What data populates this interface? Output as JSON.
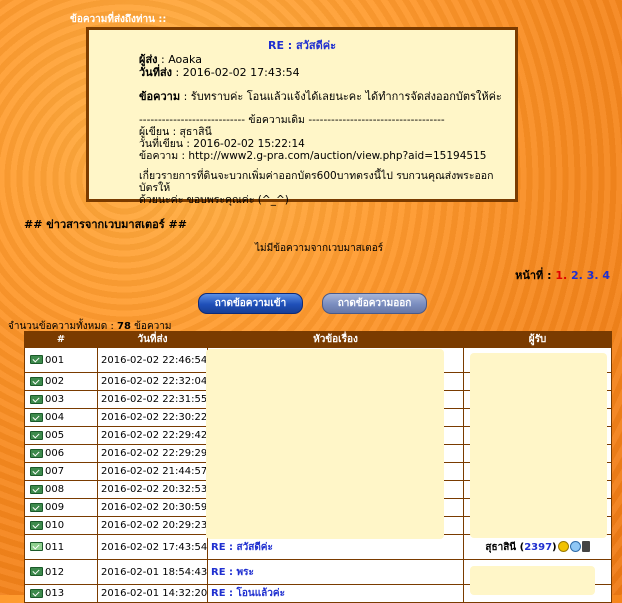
{
  "message": {
    "heading": "ข้อความที่ส่งถึงท่าน ::",
    "title": "RE : สวัสดีค่ะ",
    "sender_label": "ผู้ส่ง",
    "sender": " : Aoaka",
    "date_label": "วันที่ส่ง",
    "date": " : 2016-02-02 17:43:54",
    "body_label": "ข้อความ",
    "body": " : รับทราบค่ะ โอนแล้วแจ้งได้เลยนะคะ ได้ทำการจัดส่งออกบัตรให้ค่ะ",
    "separator": "---------------------------- ข้อความเดิม ------------------------------------",
    "orig_author": "ผู้เขียน : สุธาสินี",
    "orig_date": "วันที่เขียน : 2016-02-02 15:22:14",
    "orig_text": "ข้อความ : http://www2.g-pra.com/auction/view.php?aid=15194515",
    "orig_line1": "เกี่ยวรายการที่ดินจะบวกเพิ่มค่าออกบัตร600บาทตรงนี้ไป รบกวนคุณส่งพระออกบัตรให้",
    "orig_line2": "ด้วยนะค่ะ ขอบพระคุณค่ะ (^_^)"
  },
  "news": {
    "heading": "## ข่าวสารจากเวบมาสเตอร์ ##",
    "text": "ไม่มีข้อความจากเวบมาสเตอร์"
  },
  "pager": {
    "label": "หน้าที่ : ",
    "current": "1",
    "p2": "2",
    "p3": "3",
    "p4": "4"
  },
  "buttons": {
    "inbox": "ถาดข้อความเข้า",
    "outbox": "ถาดข้อความออก"
  },
  "count": {
    "label": "จำนวนข้อความทั้งหมด : ",
    "value": "78",
    "unit": " ข้อความ"
  },
  "table": {
    "headers": [
      "#",
      "วันที่ส่ง",
      "หัวข้อเรื่อง",
      "ผู้รับ"
    ],
    "rows": [
      {
        "num": "001",
        "date": "2016-02-02 22:46:54",
        "subject": "",
        "recipient": ""
      },
      {
        "num": "002",
        "date": "2016-02-02 22:32:04",
        "subject": "",
        "recipient": ""
      },
      {
        "num": "003",
        "date": "2016-02-02 22:31:55",
        "subject": "",
        "recipient": ""
      },
      {
        "num": "004",
        "date": "2016-02-02 22:30:22",
        "subject": "",
        "recipient": ""
      },
      {
        "num": "005",
        "date": "2016-02-02 22:29:42",
        "subject": "",
        "recipient": ""
      },
      {
        "num": "006",
        "date": "2016-02-02 22:29:29",
        "subject": "",
        "recipient": ""
      },
      {
        "num": "007",
        "date": "2016-02-02 21:44:57",
        "subject": "",
        "recipient": ""
      },
      {
        "num": "008",
        "date": "2016-02-02 20:32:53",
        "subject": "",
        "recipient": ""
      },
      {
        "num": "009",
        "date": "2016-02-02 20:30:59",
        "subject": "",
        "recipient": ""
      },
      {
        "num": "010",
        "date": "2016-02-02 20:29:23",
        "subject": "",
        "recipient": ""
      },
      {
        "num": "011",
        "date": "2016-02-02 17:43:54",
        "subject": "RE : สวัสดีค่ะ",
        "recipient": "สุธาสินี",
        "recipient_count": "2397"
      },
      {
        "num": "012",
        "date": "2016-02-01 18:54:43",
        "subject": "RE : พระ",
        "recipient": ""
      },
      {
        "num": "013",
        "date": "2016-02-01 14:32:20",
        "subject": "RE : โอนแล้วค่ะ",
        "recipient": ""
      }
    ]
  },
  "colors": {
    "header_bg": "#7a3b00",
    "link": "#1f2fd0",
    "message_bg": "#fff6c8"
  }
}
